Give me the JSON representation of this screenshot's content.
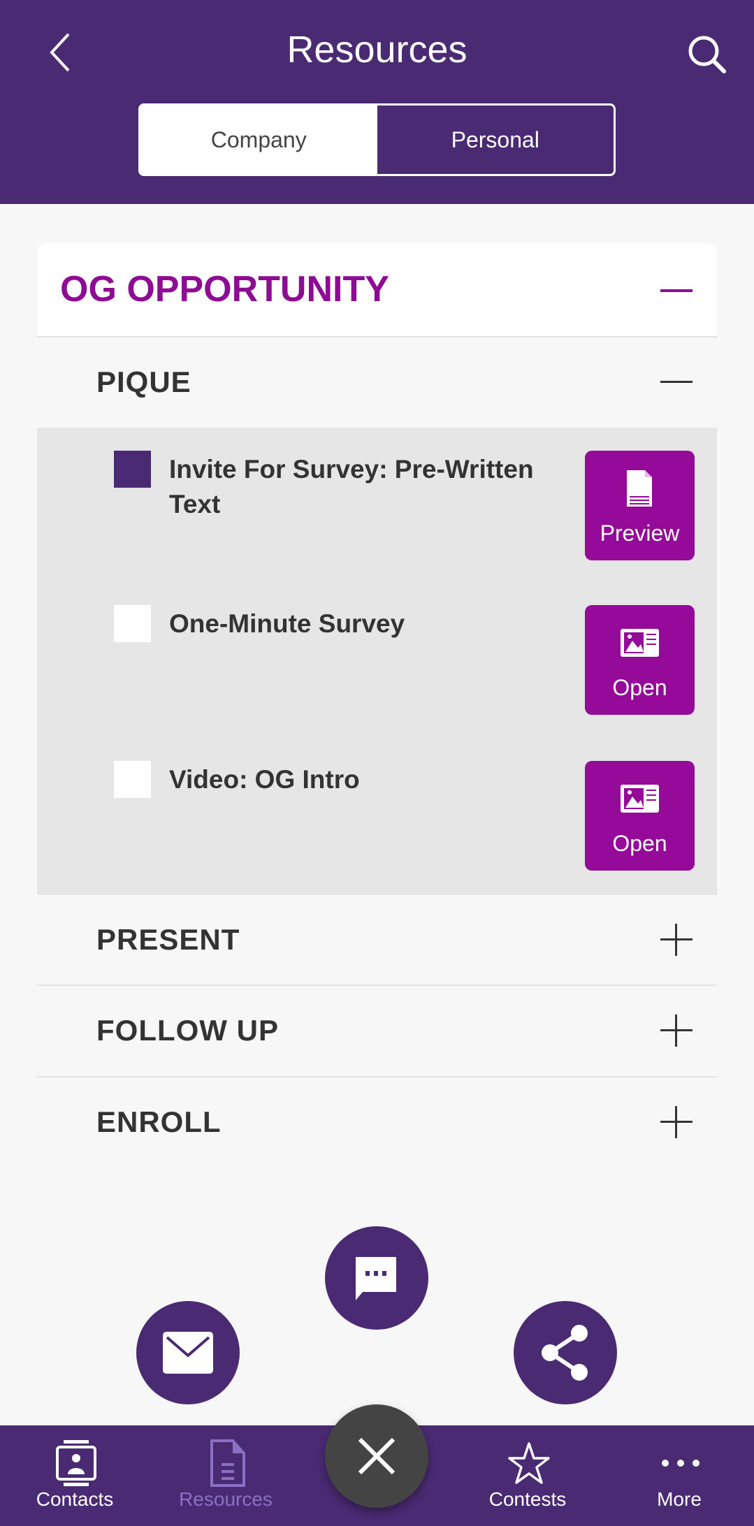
{
  "header": {
    "title": "Resources",
    "back_icon": "chevron-left-icon",
    "search_icon": "search-icon"
  },
  "segment": {
    "options": [
      "Company",
      "Personal"
    ],
    "selected": "Company"
  },
  "section": {
    "title": "OG OPPORTUNITY",
    "expanded": true
  },
  "groups": [
    {
      "label": "PIQUE",
      "expanded": true,
      "items": [
        {
          "title": "Invite For Survey: Pre-Written Text",
          "checked": true,
          "action": "Preview",
          "icon": "document-icon"
        },
        {
          "title": "One-Minute Survey",
          "checked": false,
          "action": "Open",
          "icon": "media-icon"
        },
        {
          "title": "Video: OG Intro",
          "checked": false,
          "action": "Open",
          "icon": "media-icon"
        }
      ]
    },
    {
      "label": "PRESENT",
      "expanded": false
    },
    {
      "label": "FOLLOW UP",
      "expanded": false
    },
    {
      "label": "ENROLL",
      "expanded": false
    }
  ],
  "fab": {
    "actions": [
      "email-icon",
      "chat-icon",
      "share-icon"
    ],
    "close_icon": "close-icon"
  },
  "nav": {
    "items": [
      {
        "label": "Contacts"
      },
      {
        "label": "Resources",
        "active": true
      },
      {
        "label": "Contests"
      },
      {
        "label": "More"
      }
    ]
  },
  "colors": {
    "primary": "#4a2a73",
    "accent": "#960a9a",
    "nav_active": "#8a6fc4"
  }
}
